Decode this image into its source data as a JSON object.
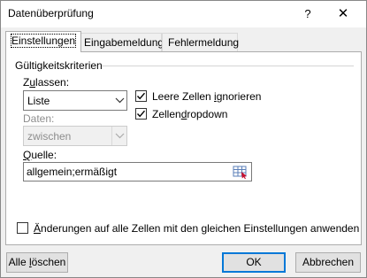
{
  "window": {
    "title": "Datenüberprüfung",
    "help_glyph": "?",
    "close_glyph": "✕"
  },
  "tabs": [
    {
      "label": "Einstellungen",
      "active": true
    },
    {
      "label": "Eingabemeldung",
      "active": false
    },
    {
      "label": "Fehlermeldung",
      "active": false
    }
  ],
  "criteria": {
    "group_label": "Gültigkeitskriterien",
    "allow_label_pre": "Z",
    "allow_label_u": "u",
    "allow_label_post": "lassen:",
    "allow_value": "Liste",
    "ignore_blank_pre": "Leere Zellen ",
    "ignore_blank_u": "i",
    "ignore_blank_post": "gnorieren",
    "ignore_blank_checked": true,
    "dropdown_pre": "Zellen",
    "dropdown_u": "d",
    "dropdown_post": "ropdown",
    "dropdown_checked": true,
    "data_label": "Daten:",
    "data_value": "zwischen",
    "source_label_u": "Q",
    "source_label_post": "uelle:",
    "source_value": "allgemein;ermäßigt"
  },
  "apply_all": {
    "label_u": "Ä",
    "label_post": "nderungen auf alle Zellen mit den gleichen Einstellungen anwenden",
    "checked": false
  },
  "buttons": {
    "clear_all_pre": "Alle ",
    "clear_all_u": "l",
    "clear_all_post": "öschen",
    "ok": "OK",
    "cancel": "Abbrechen"
  }
}
